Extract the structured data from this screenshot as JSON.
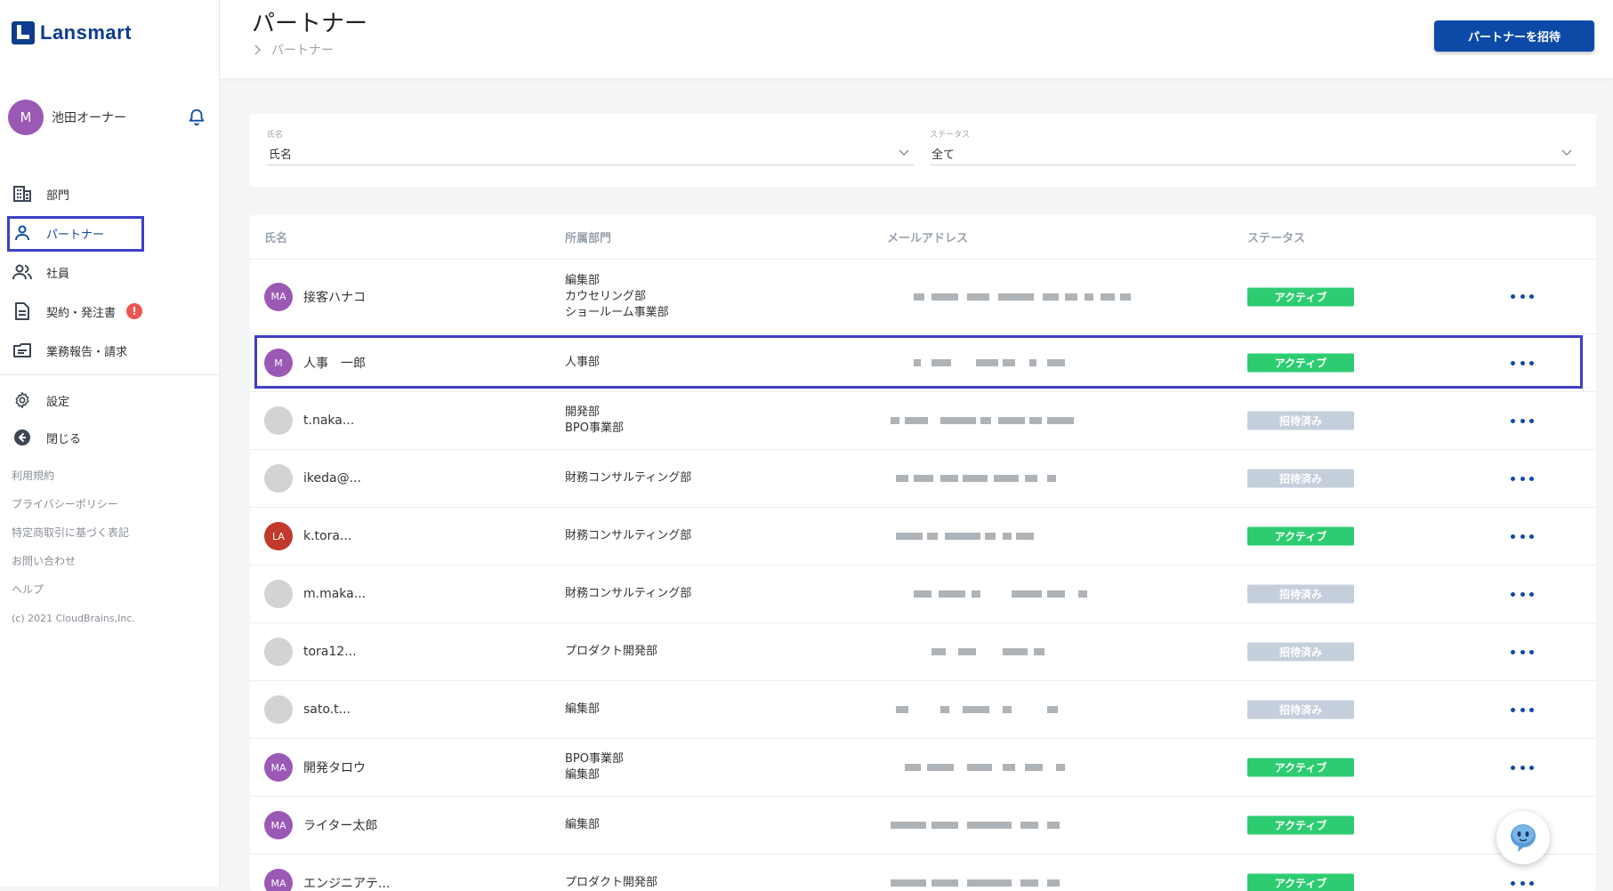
{
  "app": {
    "logo_text": "Lansmart"
  },
  "user": {
    "avatar_initial": "M",
    "name": "池田オーナー"
  },
  "nav": [
    {
      "label": "部門",
      "icon": "building-icon"
    },
    {
      "label": "パートナー",
      "icon": "person-icon",
      "active": true
    },
    {
      "label": "社員",
      "icon": "people-icon"
    },
    {
      "label": "契約・発注書",
      "icon": "document-icon",
      "badge": "!"
    },
    {
      "label": "業務報告・請求",
      "icon": "report-icon"
    }
  ],
  "nav2": [
    {
      "label": "設定",
      "icon": "gear-icon"
    },
    {
      "label": "閉じる",
      "icon": "back-arrow-icon"
    }
  ],
  "footer_links": [
    "利用規約",
    "プライバシーポリシー",
    "特定商取引に基づく表記",
    "お問い合わせ",
    "ヘルプ"
  ],
  "copyright": "(c) 2021 CloudBrains,Inc.",
  "header": {
    "title": "パートナー",
    "breadcrumb": "パートナー",
    "invite_button": "パートナーを招待"
  },
  "filters": {
    "name": {
      "label": "氏名",
      "value": "氏名"
    },
    "status": {
      "label": "ステータス",
      "value": "全て"
    }
  },
  "table": {
    "columns": {
      "name": "氏名",
      "dept": "所属部門",
      "mail": "メールアドレス",
      "status": "ステータス"
    },
    "rows": [
      {
        "initials": "MA",
        "avatar_color": "#9b59b6",
        "name": "接客ハナコ",
        "depts": [
          "編集部",
          "カウセリング部",
          "ショールーム事業部"
        ],
        "status": "アクティブ",
        "status_type": "active"
      },
      {
        "initials": "M",
        "avatar_color": "#9b59b6",
        "name": "人事　一郎",
        "depts": [
          "人事部"
        ],
        "status": "アクティブ",
        "status_type": "active",
        "highlight": true
      },
      {
        "initials": "",
        "avatar_color": "#d3d3d3",
        "name": "t.naka...",
        "depts": [
          "開発部",
          "BPO事業部"
        ],
        "status": "招待済み",
        "status_type": "invited"
      },
      {
        "initials": "",
        "avatar_color": "#d3d3d3",
        "name": "ikeda@...",
        "depts": [
          "財務コンサルティング部"
        ],
        "status": "招待済み",
        "status_type": "invited"
      },
      {
        "initials": "LA",
        "avatar_color": "#c0392b",
        "name": "k.tora...",
        "depts": [
          "財務コンサルティング部"
        ],
        "status": "アクティブ",
        "status_type": "active"
      },
      {
        "initials": "",
        "avatar_color": "#d3d3d3",
        "name": "m.maka...",
        "depts": [
          "財務コンサルティング部"
        ],
        "status": "招待済み",
        "status_type": "invited"
      },
      {
        "initials": "",
        "avatar_color": "#d3d3d3",
        "name": "tora12...",
        "depts": [
          "プロダクト開発部"
        ],
        "status": "招待済み",
        "status_type": "invited"
      },
      {
        "initials": "",
        "avatar_color": "#d3d3d3",
        "name": "sato.t...",
        "depts": [
          "編集部"
        ],
        "status": "招待済み",
        "status_type": "invited"
      },
      {
        "initials": "MA",
        "avatar_color": "#9b59b6",
        "name": "開発タロウ",
        "depts": [
          "BPO事業部",
          "編集部"
        ],
        "status": "アクティブ",
        "status_type": "active"
      },
      {
        "initials": "MA",
        "avatar_color": "#9b59b6",
        "name": "ライター太郎",
        "depts": [
          "編集部"
        ],
        "status": "アクティブ",
        "status_type": "active"
      },
      {
        "initials": "MA",
        "avatar_color": "#9b59b6",
        "name": "エンジニアテ...",
        "depts": [
          "プロダクト開発部"
        ],
        "status": "アクティブ",
        "status_type": "active"
      }
    ]
  },
  "colors": {
    "brand": "#0d4aa8",
    "active": "#2ecc71",
    "invited": "#c5cfdc",
    "highlight_border": "#3f3fc8"
  }
}
